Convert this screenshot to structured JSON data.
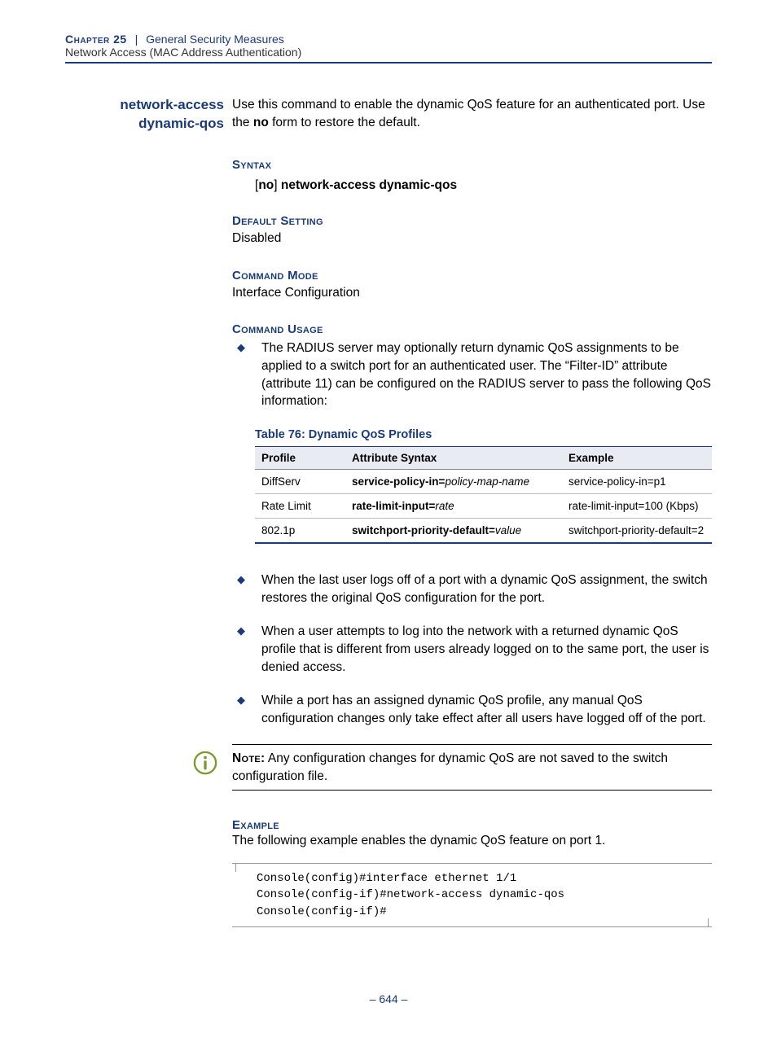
{
  "header": {
    "chapter": "Chapter 25",
    "section_title": "General Security Measures",
    "subsection": "Network Access (MAC Address Authentication)"
  },
  "command": {
    "name_line1": "network-access",
    "name_line2": "dynamic-qos",
    "description_pre": "Use this command to enable the dynamic QoS feature for an authenticated port. Use the ",
    "description_bold": "no",
    "description_post": " form to restore the default."
  },
  "syntax": {
    "heading": "Syntax",
    "bracket_open": "[",
    "no": "no",
    "bracket_close": "] ",
    "rest": "network-access dynamic-qos"
  },
  "default_setting": {
    "heading": "Default Setting",
    "value": "Disabled"
  },
  "command_mode": {
    "heading": "Command Mode",
    "value": "Interface Configuration"
  },
  "command_usage": {
    "heading": "Command Usage",
    "bullet1": "The RADIUS server may optionally return dynamic QoS assignments to be applied to a switch port for an authenticated user. The “Filter-ID” attribute (attribute 11) can be configured on the RADIUS server to pass the following QoS information:"
  },
  "table": {
    "caption": "Table 76: Dynamic QoS Profiles",
    "headers": [
      "Profile",
      "Attribute Syntax",
      "Example"
    ],
    "rows": [
      {
        "profile": "DiffServ",
        "attr_bold": "service-policy-in=",
        "attr_italic": "policy-map-name",
        "example": "service-policy-in=p1"
      },
      {
        "profile": "Rate Limit",
        "attr_bold": "rate-limit-input=",
        "attr_italic": "rate",
        "example": "rate-limit-input=100 (Kbps)"
      },
      {
        "profile": "802.1p",
        "attr_bold": "switchport-priority-default=",
        "attr_italic": "value",
        "example": "switchport-priority-default=2"
      }
    ]
  },
  "post_bullets": [
    "When the last user logs off of a port with a dynamic QoS assignment, the switch restores the original QoS configuration for the port.",
    "When a user attempts to log into the network with a returned dynamic QoS profile that is different from users already logged on to the same port, the user is denied access.",
    "While a port has an assigned dynamic QoS profile, any manual QoS configuration changes only take effect after all users have logged off of the port."
  ],
  "note": {
    "label": "Note:",
    "text": " Any configuration changes for dynamic QoS are not saved to the switch configuration file."
  },
  "example": {
    "heading": "Example",
    "intro": "The following example enables the dynamic QoS feature on port 1.",
    "code": "Console(config)#interface ethernet 1/1\nConsole(config-if)#network-access dynamic-qos\nConsole(config-if)#"
  },
  "page_number": "–  644  –"
}
